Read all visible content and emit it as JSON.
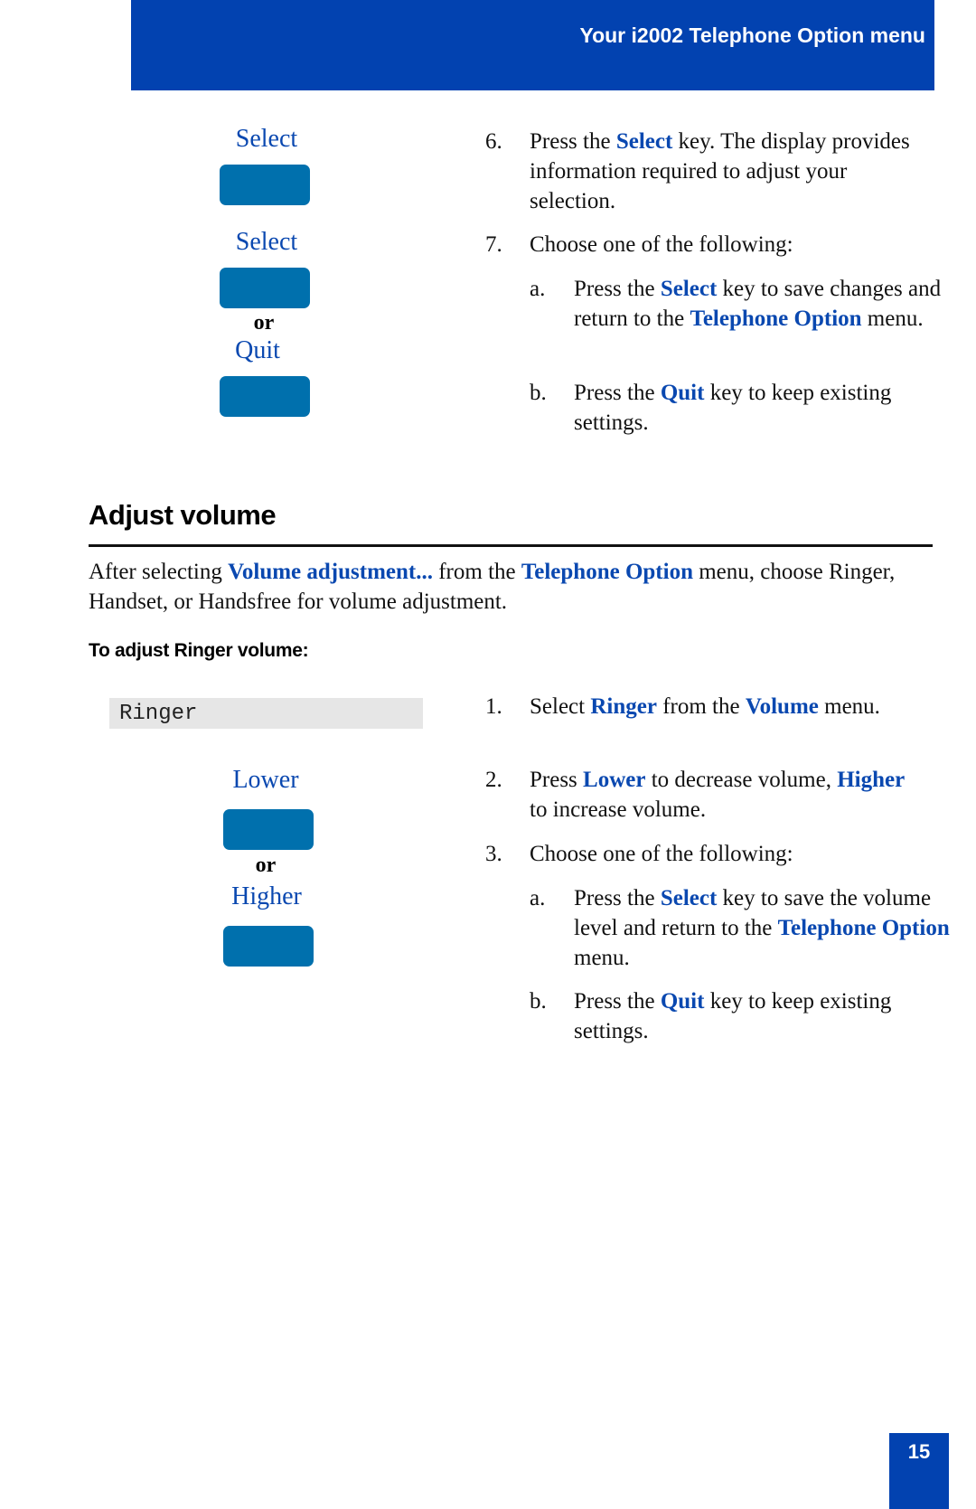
{
  "header": {
    "title": "Your i2002 Telephone Option menu"
  },
  "colors": {
    "brand_blue": "#0242b0",
    "key_blue": "#0070ad",
    "link_blue": "#0a48b0"
  },
  "top_section": {
    "keys": {
      "select1_label": "Select",
      "select2_label": "Select",
      "or_label": "or",
      "quit_label": "Quit"
    },
    "steps": [
      {
        "num": "6.",
        "pre": "Press the ",
        "bold": "Select",
        "post": " key. The display provides information required to adjust your selection."
      },
      {
        "num": "7.",
        "text": "Choose one of the following:"
      }
    ],
    "substeps": [
      {
        "num": "a.",
        "pre": "Press the ",
        "bold1": "Select",
        "mid": " key to save changes and return to the ",
        "bold2": "Telephone Option",
        "post": " menu."
      },
      {
        "num": "b.",
        "pre": "Press the ",
        "bold": "Quit",
        "post": " key to keep existing settings."
      }
    ]
  },
  "section": {
    "title": "Adjust volume",
    "intro": {
      "pre": "After selecting ",
      "bold1": "Volume adjustment...",
      "mid": " from the ",
      "bold2": "Telephone Option",
      "post": " menu, choose Ringer, Handset, or Handsfree for volume adjustment."
    },
    "subheading": "To adjust Ringer volume:",
    "display_text": "Ringer",
    "keys": {
      "lower_label": "Lower",
      "or_label": "or",
      "higher_label": "Higher"
    },
    "steps": [
      {
        "num": "1.",
        "pre": "Select ",
        "bold1": "Ringer",
        "mid": " from the ",
        "bold2": "Volume",
        "post": " menu."
      },
      {
        "num": "2.",
        "pre": "Press ",
        "bold1": "Lower",
        "mid": " to decrease volume, ",
        "bold2": "Higher",
        "post": " to increase volume."
      },
      {
        "num": "3.",
        "text": "Choose one of the following:"
      }
    ],
    "substeps": [
      {
        "num": "a.",
        "pre": "Press the ",
        "bold1": "Select",
        "mid": " key to save the volume level and return to the ",
        "bold2": "Telephone Option",
        "post": " menu."
      },
      {
        "num": "b.",
        "pre": "Press the ",
        "bold": "Quit",
        "post": " key to keep existing settings."
      }
    ]
  },
  "footer": {
    "page_number": "15"
  }
}
